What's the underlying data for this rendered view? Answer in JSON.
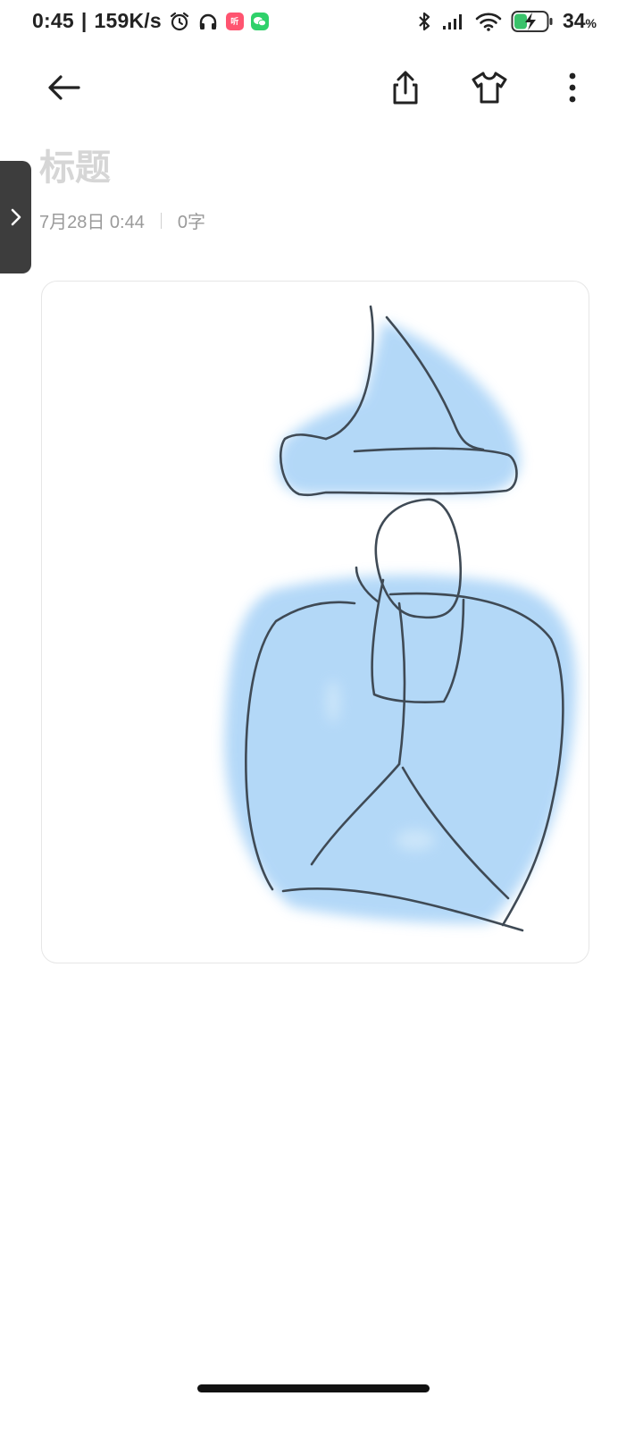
{
  "status_bar": {
    "time": "0:45",
    "separator": "|",
    "net_speed": "159K/s",
    "icons": [
      "alarm-icon",
      "headphones-icon",
      "app-notification-icon",
      "wechat-icon",
      "bluetooth-icon",
      "signal-icon",
      "wifi-icon",
      "battery-charging-icon"
    ],
    "app_badge_text": "听",
    "battery_percent": "34",
    "battery_unit": "%",
    "battery_level": 0.34
  },
  "toolbar": {
    "icons": [
      "back-arrow-icon",
      "share-icon",
      "tshirt-icon",
      "more-vertical-icon"
    ]
  },
  "note": {
    "title_placeholder": "标题",
    "date": "7月28日 0:44",
    "word_count": "0字"
  },
  "drawing": {
    "description_colors": {
      "stroke": "#3f4a55",
      "fill": "#a9d3f7"
    }
  }
}
